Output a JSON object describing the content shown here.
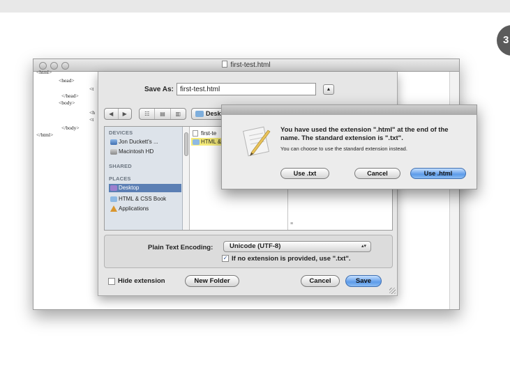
{
  "step_badge": "3",
  "window": {
    "title": "first-test.html"
  },
  "document_code": {
    "lines": [
      "<html>",
      "<head>",
      "</head>",
      "<body>",
      "</body>",
      "</html>"
    ],
    "fragments": [
      "<t",
      "<h",
      "<t"
    ]
  },
  "save_sheet": {
    "save_as_label": "Save As:",
    "filename_value": "first-test.html",
    "expand_symbol": "▲",
    "nav_back_forward": [
      "◀",
      "▶"
    ],
    "view_modes": [
      "☷",
      "▤",
      "▥"
    ],
    "location": "Desktop",
    "sidebar": {
      "devices_header": "DEVICES",
      "devices": [
        "Jon Duckett's ...",
        "Macintosh HD"
      ],
      "shared_header": "SHARED",
      "places_header": "PLACES",
      "places": [
        "Desktop",
        "HTML & CSS Book",
        "Applications"
      ]
    },
    "files": [
      {
        "name": "first-te",
        "kind": "document"
      },
      {
        "name": "HTML &",
        "kind": "folder",
        "highlight": true
      }
    ],
    "encoding_label": "Plain Text Encoding:",
    "encoding_value": "Unicode (UTF-8)",
    "ext_checkbox_label": "If no extension is provided, use \".txt\".",
    "hide_extension_label": "Hide extension",
    "new_folder_label": "New Folder",
    "cancel_label": "Cancel",
    "save_label": "Save"
  },
  "alert": {
    "title": "You have used the extension \".html\" at the end of the name. The standard extension is \".txt\".",
    "message": "You can choose to use the standard extension instead.",
    "use_txt_label": "Use .txt",
    "cancel_label": "Cancel",
    "use_html_label": "Use .html"
  },
  "colors": {
    "primary_button": "#5d9be9",
    "sidebar_selection": "#5b7fb4",
    "file_highlight": "#f6ec7a"
  }
}
